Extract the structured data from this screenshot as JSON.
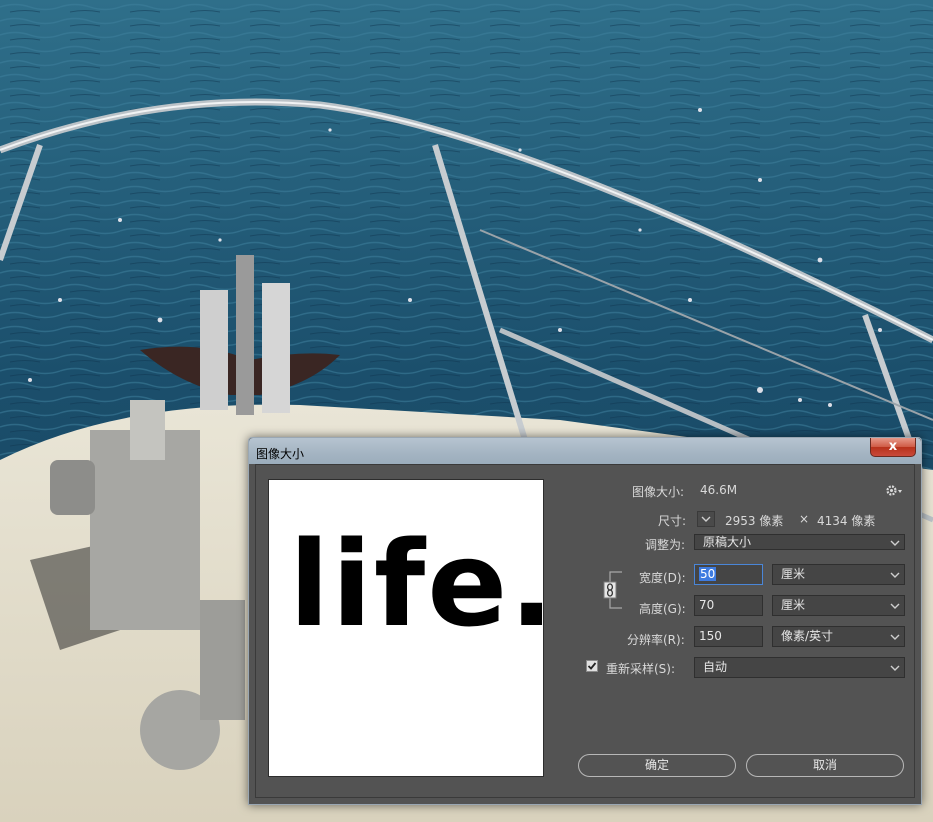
{
  "dialog": {
    "title": "图像大小",
    "close_label": "x",
    "preview_text": "life."
  },
  "image_size": {
    "label": "图像大小:",
    "value": "46.6M"
  },
  "dimensions": {
    "label": "尺寸:",
    "width_value": "2953 像素",
    "times": "×",
    "height_value": "4134 像素"
  },
  "fit_to": {
    "label": "调整为:",
    "value": "原稿大小"
  },
  "width": {
    "label": "宽度(D):",
    "value": "50",
    "unit": "厘米"
  },
  "height": {
    "label": "高度(G):",
    "value": "70",
    "unit": "厘米"
  },
  "resolution": {
    "label": "分辨率(R):",
    "value": "150",
    "unit": "像素/英寸"
  },
  "resample": {
    "label": "重新采样(S):",
    "value": "自动",
    "checked": true
  },
  "buttons": {
    "ok": "确定",
    "cancel": "取消"
  },
  "icons": {
    "settings": "gear-icon",
    "link": "chain-link-icon",
    "dropdown": "chevron-down-icon",
    "close": "close-icon"
  }
}
